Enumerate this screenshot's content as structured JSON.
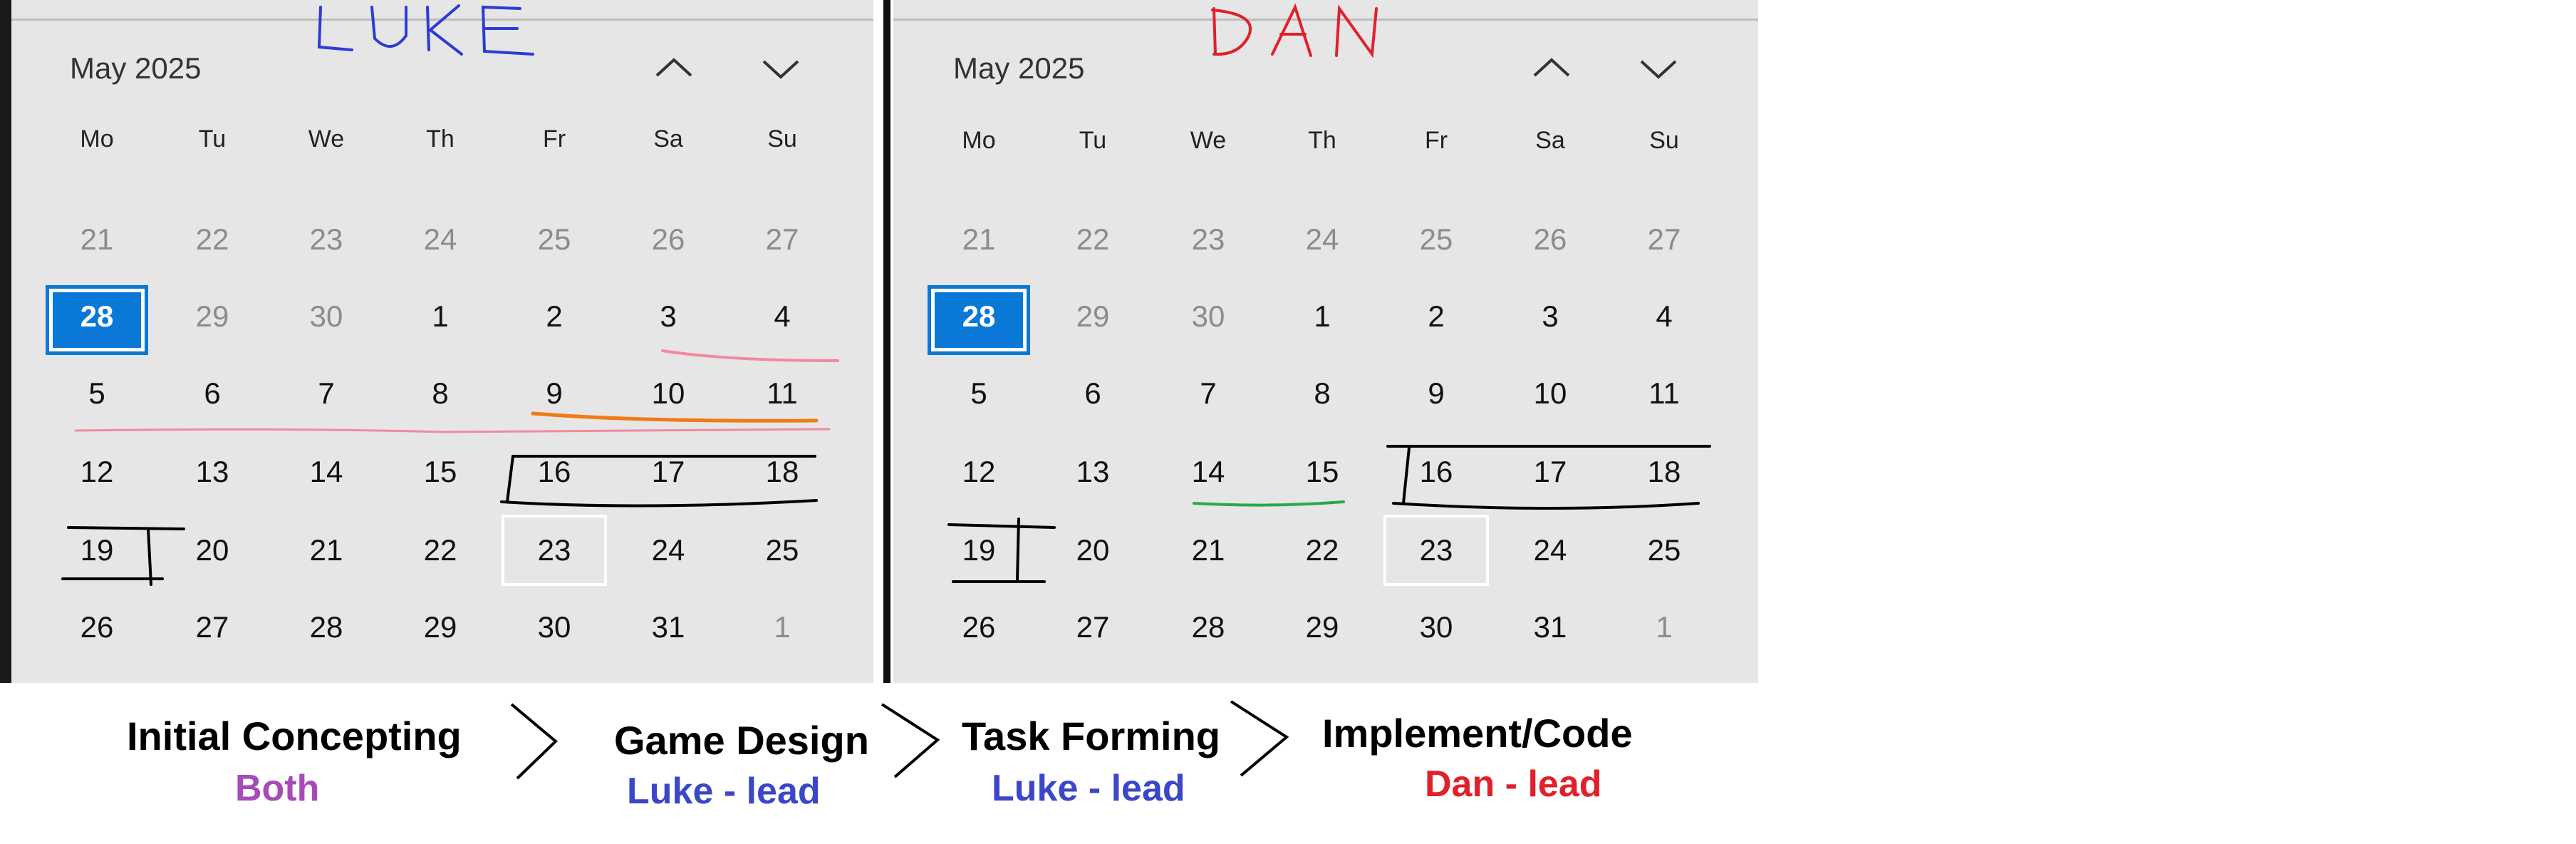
{
  "calendars": [
    {
      "id": "luke",
      "month_label": "May 2025",
      "handwritten_name": "LUKE",
      "name_color": "#2d3bd6",
      "weekdays": [
        "Mo",
        "Tu",
        "We",
        "Th",
        "Fr",
        "Sa",
        "Su"
      ],
      "weeks": [
        [
          "21",
          "22",
          "23",
          "24",
          "25",
          "26",
          "27"
        ],
        [
          "28",
          "29",
          "30",
          "1",
          "2",
          "3",
          "4"
        ],
        [
          "5",
          "6",
          "7",
          "8",
          "9",
          "10",
          "11"
        ],
        [
          "12",
          "13",
          "14",
          "15",
          "16",
          "17",
          "18"
        ],
        [
          "19",
          "20",
          "21",
          "22",
          "23",
          "24",
          "25"
        ],
        [
          "26",
          "27",
          "28",
          "29",
          "30",
          "31",
          "1"
        ]
      ],
      "today": "28",
      "selected": "23"
    },
    {
      "id": "dan",
      "month_label": "May 2025",
      "handwritten_name": "DAN",
      "name_color": "#e0202a",
      "weekdays": [
        "Mo",
        "Tu",
        "We",
        "Th",
        "Fr",
        "Sa",
        "Su"
      ],
      "weeks": [
        [
          "21",
          "22",
          "23",
          "24",
          "25",
          "26",
          "27"
        ],
        [
          "28",
          "29",
          "30",
          "1",
          "2",
          "3",
          "4"
        ],
        [
          "5",
          "6",
          "7",
          "8",
          "9",
          "10",
          "11"
        ],
        [
          "12",
          "13",
          "14",
          "15",
          "16",
          "17",
          "18"
        ],
        [
          "19",
          "20",
          "21",
          "22",
          "23",
          "24",
          "25"
        ],
        [
          "26",
          "27",
          "28",
          "29",
          "30",
          "31",
          "1"
        ]
      ],
      "today": "28",
      "selected": "23"
    }
  ],
  "phases": [
    {
      "title": "Initial Concepting",
      "lead": "Both",
      "lead_color": "#a64bb7"
    },
    {
      "title": "Game Design",
      "lead": "Luke - lead",
      "lead_color": "#3b47c8"
    },
    {
      "title": "Task Forming",
      "lead": "Luke - lead",
      "lead_color": "#3b47c8"
    },
    {
      "title": "Implement/Code",
      "lead": "Dan - lead",
      "lead_color": "#e0202a"
    }
  ],
  "colors": {
    "accent": "#0a78d7",
    "panel_bg": "#e6e6e6",
    "ink_black": "#000000",
    "ink_pink": "#f08aa0",
    "ink_orange": "#f07a18",
    "ink_green": "#2aa84a"
  },
  "icons": {
    "prev": "chevron-up-icon",
    "next": "chevron-down-icon",
    "arrow": "chevron-right-icon"
  }
}
